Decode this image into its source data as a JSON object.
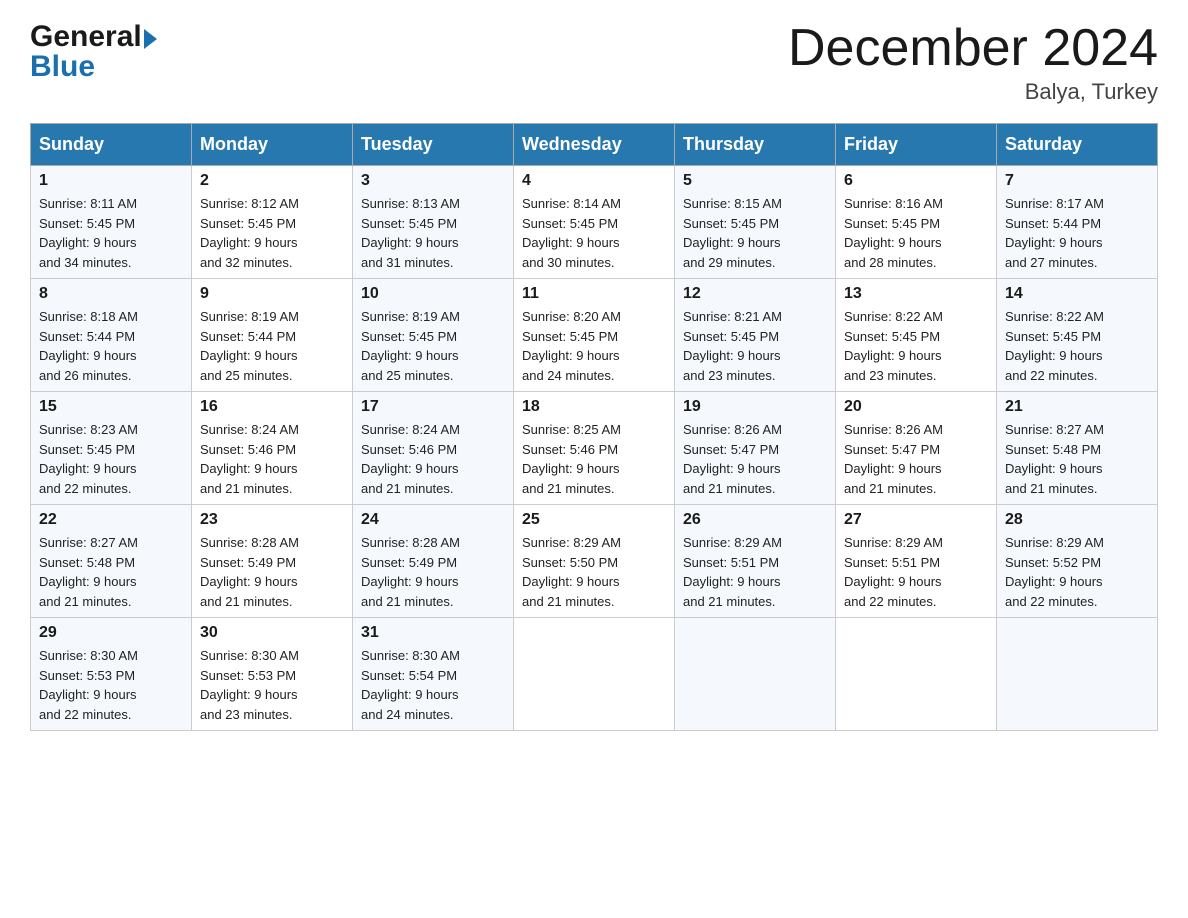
{
  "header": {
    "logo": {
      "general": "General",
      "arrow": "▶",
      "blue": "Blue"
    },
    "title": "December 2024",
    "location": "Balya, Turkey"
  },
  "days_of_week": [
    "Sunday",
    "Monday",
    "Tuesday",
    "Wednesday",
    "Thursday",
    "Friday",
    "Saturday"
  ],
  "weeks": [
    [
      {
        "day": "1",
        "sunrise": "8:11 AM",
        "sunset": "5:45 PM",
        "daylight": "9 hours and 34 minutes."
      },
      {
        "day": "2",
        "sunrise": "8:12 AM",
        "sunset": "5:45 PM",
        "daylight": "9 hours and 32 minutes."
      },
      {
        "day": "3",
        "sunrise": "8:13 AM",
        "sunset": "5:45 PM",
        "daylight": "9 hours and 31 minutes."
      },
      {
        "day": "4",
        "sunrise": "8:14 AM",
        "sunset": "5:45 PM",
        "daylight": "9 hours and 30 minutes."
      },
      {
        "day": "5",
        "sunrise": "8:15 AM",
        "sunset": "5:45 PM",
        "daylight": "9 hours and 29 minutes."
      },
      {
        "day": "6",
        "sunrise": "8:16 AM",
        "sunset": "5:45 PM",
        "daylight": "9 hours and 28 minutes."
      },
      {
        "day": "7",
        "sunrise": "8:17 AM",
        "sunset": "5:44 PM",
        "daylight": "9 hours and 27 minutes."
      }
    ],
    [
      {
        "day": "8",
        "sunrise": "8:18 AM",
        "sunset": "5:44 PM",
        "daylight": "9 hours and 26 minutes."
      },
      {
        "day": "9",
        "sunrise": "8:19 AM",
        "sunset": "5:44 PM",
        "daylight": "9 hours and 25 minutes."
      },
      {
        "day": "10",
        "sunrise": "8:19 AM",
        "sunset": "5:45 PM",
        "daylight": "9 hours and 25 minutes."
      },
      {
        "day": "11",
        "sunrise": "8:20 AM",
        "sunset": "5:45 PM",
        "daylight": "9 hours and 24 minutes."
      },
      {
        "day": "12",
        "sunrise": "8:21 AM",
        "sunset": "5:45 PM",
        "daylight": "9 hours and 23 minutes."
      },
      {
        "day": "13",
        "sunrise": "8:22 AM",
        "sunset": "5:45 PM",
        "daylight": "9 hours and 23 minutes."
      },
      {
        "day": "14",
        "sunrise": "8:22 AM",
        "sunset": "5:45 PM",
        "daylight": "9 hours and 22 minutes."
      }
    ],
    [
      {
        "day": "15",
        "sunrise": "8:23 AM",
        "sunset": "5:45 PM",
        "daylight": "9 hours and 22 minutes."
      },
      {
        "day": "16",
        "sunrise": "8:24 AM",
        "sunset": "5:46 PM",
        "daylight": "9 hours and 21 minutes."
      },
      {
        "day": "17",
        "sunrise": "8:24 AM",
        "sunset": "5:46 PM",
        "daylight": "9 hours and 21 minutes."
      },
      {
        "day": "18",
        "sunrise": "8:25 AM",
        "sunset": "5:46 PM",
        "daylight": "9 hours and 21 minutes."
      },
      {
        "day": "19",
        "sunrise": "8:26 AM",
        "sunset": "5:47 PM",
        "daylight": "9 hours and 21 minutes."
      },
      {
        "day": "20",
        "sunrise": "8:26 AM",
        "sunset": "5:47 PM",
        "daylight": "9 hours and 21 minutes."
      },
      {
        "day": "21",
        "sunrise": "8:27 AM",
        "sunset": "5:48 PM",
        "daylight": "9 hours and 21 minutes."
      }
    ],
    [
      {
        "day": "22",
        "sunrise": "8:27 AM",
        "sunset": "5:48 PM",
        "daylight": "9 hours and 21 minutes."
      },
      {
        "day": "23",
        "sunrise": "8:28 AM",
        "sunset": "5:49 PM",
        "daylight": "9 hours and 21 minutes."
      },
      {
        "day": "24",
        "sunrise": "8:28 AM",
        "sunset": "5:49 PM",
        "daylight": "9 hours and 21 minutes."
      },
      {
        "day": "25",
        "sunrise": "8:29 AM",
        "sunset": "5:50 PM",
        "daylight": "9 hours and 21 minutes."
      },
      {
        "day": "26",
        "sunrise": "8:29 AM",
        "sunset": "5:51 PM",
        "daylight": "9 hours and 21 minutes."
      },
      {
        "day": "27",
        "sunrise": "8:29 AM",
        "sunset": "5:51 PM",
        "daylight": "9 hours and 22 minutes."
      },
      {
        "day": "28",
        "sunrise": "8:29 AM",
        "sunset": "5:52 PM",
        "daylight": "9 hours and 22 minutes."
      }
    ],
    [
      {
        "day": "29",
        "sunrise": "8:30 AM",
        "sunset": "5:53 PM",
        "daylight": "9 hours and 22 minutes."
      },
      {
        "day": "30",
        "sunrise": "8:30 AM",
        "sunset": "5:53 PM",
        "daylight": "9 hours and 23 minutes."
      },
      {
        "day": "31",
        "sunrise": "8:30 AM",
        "sunset": "5:54 PM",
        "daylight": "9 hours and 24 minutes."
      },
      null,
      null,
      null,
      null
    ]
  ],
  "labels": {
    "sunrise": "Sunrise: ",
    "sunset": "Sunset: ",
    "daylight": "Daylight: "
  }
}
